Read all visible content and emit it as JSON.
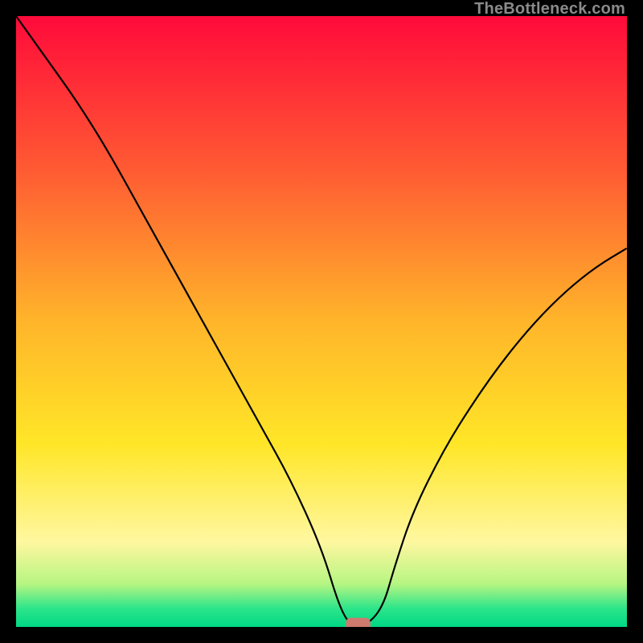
{
  "watermark": "TheBottleneck.com",
  "chart_data": {
    "type": "line",
    "title": "",
    "xlabel": "",
    "ylabel": "",
    "xlim": [
      0,
      100
    ],
    "ylim": [
      0,
      100
    ],
    "grid": false,
    "legend": false,
    "background": {
      "type": "vertical-gradient",
      "stops": [
        {
          "pos": 0.0,
          "color": "#ff0a3a"
        },
        {
          "pos": 0.25,
          "color": "#ff5a33"
        },
        {
          "pos": 0.5,
          "color": "#ffb52a"
        },
        {
          "pos": 0.7,
          "color": "#ffe627"
        },
        {
          "pos": 0.86,
          "color": "#fff7a0"
        },
        {
          "pos": 0.93,
          "color": "#b6f582"
        },
        {
          "pos": 0.97,
          "color": "#2ce58a"
        },
        {
          "pos": 1.0,
          "color": "#00d884"
        }
      ]
    },
    "series": [
      {
        "name": "bottleneck-curve",
        "color": "#000000",
        "x": [
          0,
          5,
          10,
          15,
          20,
          25,
          30,
          35,
          40,
          45,
          50,
          53,
          55,
          57,
          60,
          62,
          65,
          70,
          75,
          80,
          85,
          90,
          95,
          100
        ],
        "y": [
          100,
          93,
          86,
          78,
          69,
          60,
          51,
          42,
          33,
          24,
          13,
          3,
          0,
          0,
          3,
          10,
          19,
          29,
          37,
          44,
          50,
          55,
          59,
          62
        ]
      }
    ],
    "marker": {
      "name": "optimal-marker",
      "shape": "rounded-rect",
      "x": 56,
      "y": 0,
      "width": 4,
      "height": 2.2,
      "color": "#cf7a6f"
    }
  }
}
